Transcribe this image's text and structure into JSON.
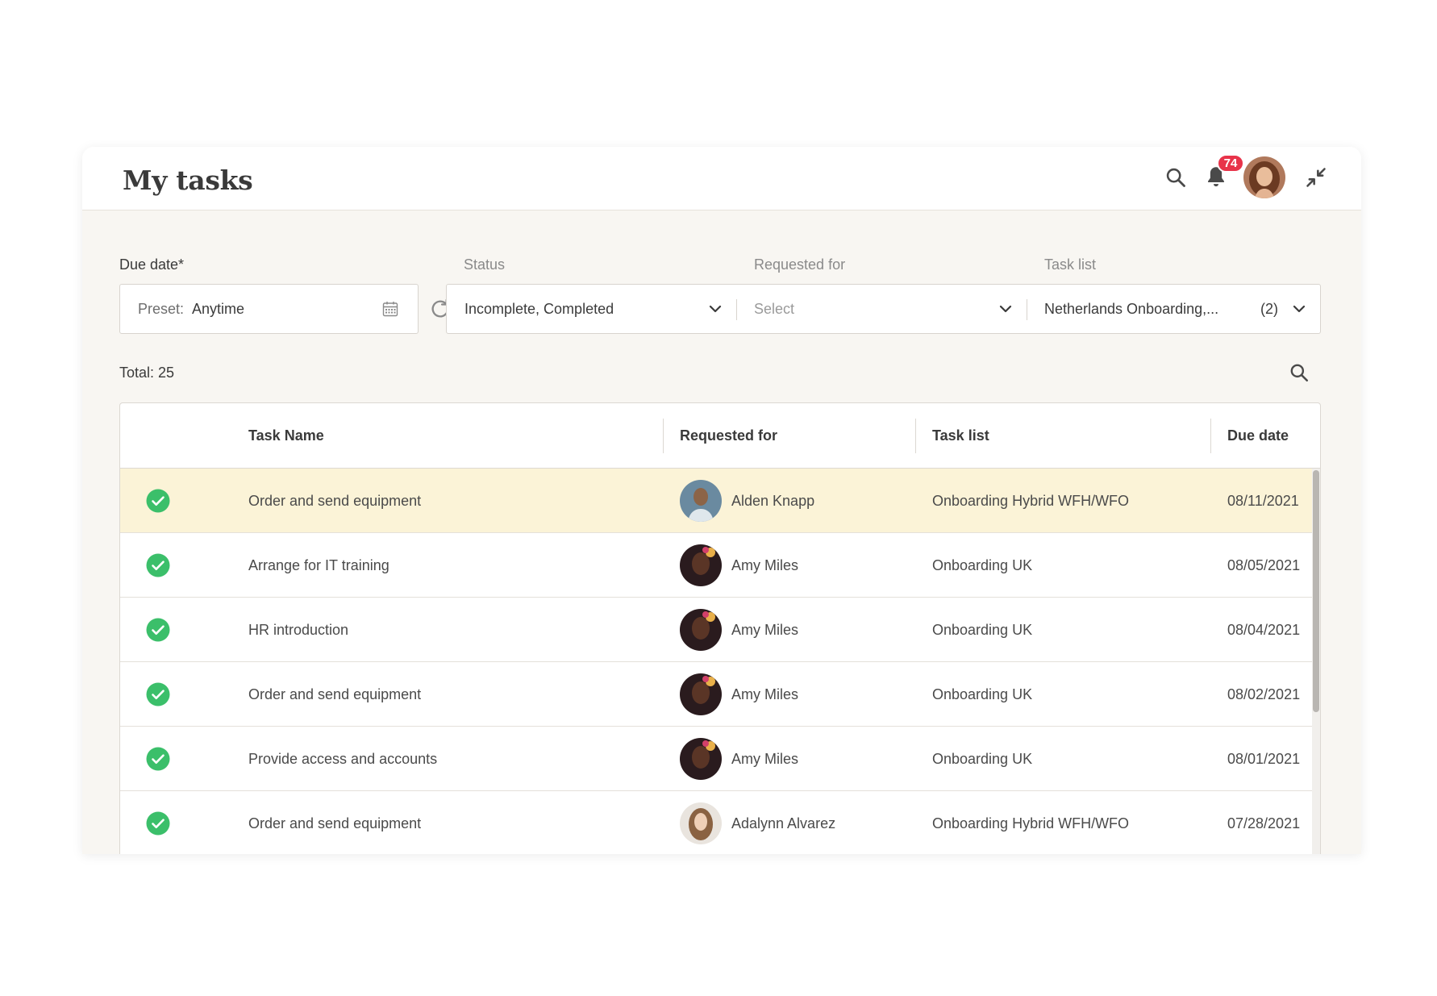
{
  "header": {
    "title": "My tasks",
    "notification_count": "74"
  },
  "filters": {
    "due_date": {
      "label": "Due date*",
      "preset_label": "Preset:",
      "preset_value": "Anytime"
    },
    "status": {
      "label": "Status",
      "value": "Incomplete, Completed"
    },
    "requested_for": {
      "label": "Requested for",
      "placeholder": "Select"
    },
    "task_list": {
      "label": "Task list",
      "value": "Netherlands Onboarding,...",
      "count": "(2)"
    }
  },
  "total": "Total: 25",
  "table": {
    "columns": {
      "task_name": "Task Name",
      "requested_for": "Requested for",
      "task_list": "Task list",
      "due_date": "Due date"
    },
    "rows": [
      {
        "task": "Order and send equipment",
        "person": "Alden Knapp",
        "list": "Onboarding Hybrid WFH/WFO",
        "due": "08/11/2021",
        "status": "completed"
      },
      {
        "task": "Arrange for IT training",
        "person": "Amy Miles",
        "list": "Onboarding UK",
        "due": "08/05/2021",
        "status": "completed"
      },
      {
        "task": "HR introduction",
        "person": "Amy Miles",
        "list": "Onboarding UK",
        "due": "08/04/2021",
        "status": "completed"
      },
      {
        "task": "Order and send equipment",
        "person": "Amy Miles",
        "list": "Onboarding UK",
        "due": "08/02/2021",
        "status": "completed"
      },
      {
        "task": "Provide access and accounts",
        "person": "Amy Miles",
        "list": "Onboarding UK",
        "due": "08/01/2021",
        "status": "completed"
      },
      {
        "task": "Order and send equipment",
        "person": "Adalynn Alvarez",
        "list": "Onboarding Hybrid WFH/WFO",
        "due": "07/28/2021",
        "status": "completed"
      }
    ]
  },
  "colors": {
    "accent_green": "#3bbf6a",
    "badge_red": "#e8334a",
    "row_highlight": "#fbf3d7",
    "panel_bg": "#f8f6f2"
  },
  "icons": {
    "search": "search-icon",
    "notifications": "bell-icon",
    "collapse": "collapse-icon",
    "calendar": "calendar-icon",
    "refresh": "refresh-icon",
    "dropdown": "chevron-down-icon",
    "status": "check-circle-icon"
  }
}
